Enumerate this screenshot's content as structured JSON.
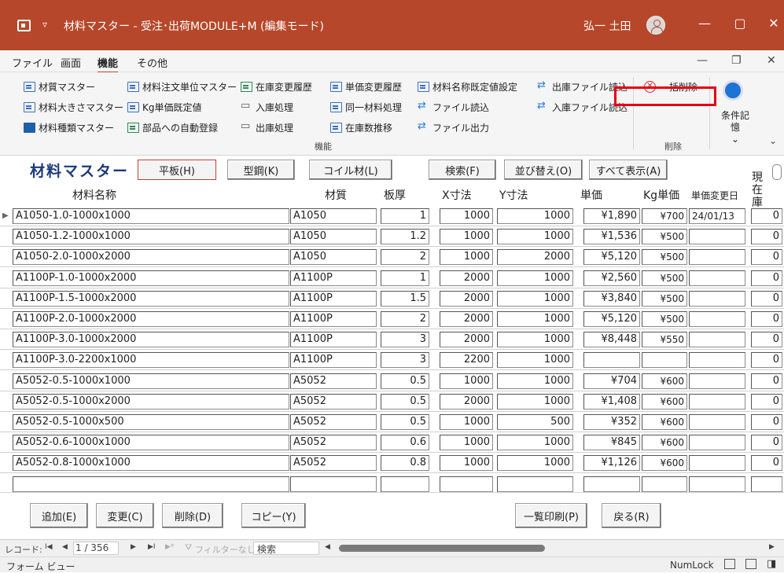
{
  "titlebar": {
    "quick_access": "▿",
    "title": "材料マスター - 受注･出荷MODULE+M (編集モード)",
    "user": "弘一 土田",
    "minimize": "—",
    "maximize": "▢",
    "close": "✕"
  },
  "menubar": {
    "items": [
      "ファイル",
      "画面",
      "機能",
      "その他"
    ],
    "restore": "❐",
    "close": "✕",
    "minimize": "—"
  },
  "ribbon": {
    "col1": [
      "材質マスター",
      "材料大きさマスター",
      "材料種類マスター"
    ],
    "col2": [
      "材料注文単位マスター",
      "Kg単価既定値",
      "部品への自動登録"
    ],
    "col3": [
      "在庫変更履歴",
      "入庫処理",
      "出庫処理"
    ],
    "col4": [
      "単価変更履歴",
      "同一材料処理",
      "在庫数推移"
    ],
    "col5": [
      "材料名称既定値設定",
      "ファイル読込",
      "ファイル出力"
    ],
    "col6": [
      "出庫ファイル読込",
      "入庫ファイル読込"
    ],
    "bulk_delete": "一括削除",
    "condition_memory": "条件記憶",
    "cond_caret": "⌄",
    "group_function": "機能",
    "group_delete": "削除",
    "collapse": "⌄"
  },
  "form": {
    "title": "材料マスター",
    "tabs": {
      "plate": "平板(H)",
      "shape": "型鋼(K)",
      "coil": "コイル材(L)"
    },
    "search": "検索(F)",
    "sort": "並び替え(O)",
    "show_all": "すべて表示(A)",
    "stock_label": "現在庫"
  },
  "columns": {
    "name": "材料名称",
    "material": "材質",
    "thickness": "板厚",
    "x": "X寸法",
    "y": "Y寸法",
    "price": "単価",
    "kg_price": "Kg単価",
    "price_change_date": "単価変更日"
  },
  "rows": [
    {
      "name": "A1050-1.0-1000x1000",
      "material": "A1050",
      "thickness": "1",
      "x": "1000",
      "y": "1000",
      "price": "¥1,890",
      "kg": "¥700",
      "date": "24/01/13",
      "stock": "0"
    },
    {
      "name": "A1050-1.2-1000x1000",
      "material": "A1050",
      "thickness": "1.2",
      "x": "1000",
      "y": "1000",
      "price": "¥1,536",
      "kg": "¥500",
      "date": "",
      "stock": "0"
    },
    {
      "name": "A1050-2.0-1000x2000",
      "material": "A1050",
      "thickness": "2",
      "x": "1000",
      "y": "2000",
      "price": "¥5,120",
      "kg": "¥500",
      "date": "",
      "stock": "0"
    },
    {
      "name": "A1100P-1.0-1000x2000",
      "material": "A1100P",
      "thickness": "1",
      "x": "2000",
      "y": "1000",
      "price": "¥2,560",
      "kg": "¥500",
      "date": "",
      "stock": "0"
    },
    {
      "name": "A1100P-1.5-1000x2000",
      "material": "A1100P",
      "thickness": "1.5",
      "x": "2000",
      "y": "1000",
      "price": "¥3,840",
      "kg": "¥500",
      "date": "",
      "stock": "0"
    },
    {
      "name": "A1100P-2.0-1000x2000",
      "material": "A1100P",
      "thickness": "2",
      "x": "2000",
      "y": "1000",
      "price": "¥5,120",
      "kg": "¥500",
      "date": "",
      "stock": "0"
    },
    {
      "name": "A1100P-3.0-1000x2000",
      "material": "A1100P",
      "thickness": "3",
      "x": "2000",
      "y": "1000",
      "price": "¥8,448",
      "kg": "¥550",
      "date": "",
      "stock": "0"
    },
    {
      "name": "A1100P-3.0-2200x1000",
      "material": "A1100P",
      "thickness": "3",
      "x": "2200",
      "y": "1000",
      "price": "",
      "kg": "",
      "date": "",
      "stock": "0"
    },
    {
      "name": "A5052-0.5-1000x1000",
      "material": "A5052",
      "thickness": "0.5",
      "x": "1000",
      "y": "1000",
      "price": "¥704",
      "kg": "¥600",
      "date": "",
      "stock": "0"
    },
    {
      "name": "A5052-0.5-1000x2000",
      "material": "A5052",
      "thickness": "0.5",
      "x": "2000",
      "y": "1000",
      "price": "¥1,408",
      "kg": "¥600",
      "date": "",
      "stock": "0"
    },
    {
      "name": "A5052-0.5-1000x500",
      "material": "A5052",
      "thickness": "0.5",
      "x": "1000",
      "y": "500",
      "price": "¥352",
      "kg": "¥600",
      "date": "",
      "stock": "0"
    },
    {
      "name": "A5052-0.6-1000x1000",
      "material": "A5052",
      "thickness": "0.6",
      "x": "1000",
      "y": "1000",
      "price": "¥845",
      "kg": "¥600",
      "date": "",
      "stock": "0"
    },
    {
      "name": "A5052-0.8-1000x1000",
      "material": "A5052",
      "thickness": "0.8",
      "x": "1000",
      "y": "1000",
      "price": "¥1,126",
      "kg": "¥600",
      "date": "",
      "stock": "0"
    }
  ],
  "footer": {
    "add": "追加(E)",
    "edit": "変更(C)",
    "delete": "削除(D)",
    "copy": "コピー(Y)",
    "print_list": "一覧印刷(P)",
    "back": "戻る(R)"
  },
  "navbar": {
    "record_label": "レコード:",
    "first": "I◀",
    "prev": "◀",
    "position": "1 / 356",
    "next": "▶",
    "last": "▶I",
    "new": "▶*",
    "filter": "フィルターなし",
    "search": "検索"
  },
  "statusbar": {
    "view": "フォーム ビュー",
    "numlock": "NumLock"
  }
}
